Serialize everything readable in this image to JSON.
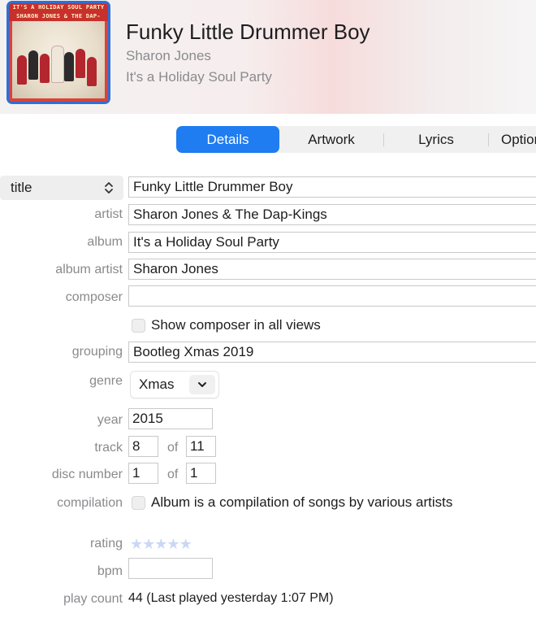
{
  "header": {
    "artwork_text_line1": "IT'S A HOLIDAY SOUL PARTY",
    "artwork_text_line2": "SHARON JONES & THE DAP-KINGS",
    "song_title": "Funky Little Drummer Boy",
    "artist": "Sharon Jones",
    "album": "It's a Holiday Soul Party"
  },
  "tabs": [
    {
      "label": "Details",
      "active": true
    },
    {
      "label": "Artwork",
      "active": false
    },
    {
      "label": "Lyrics",
      "active": false
    },
    {
      "label": "Options",
      "active": false
    }
  ],
  "details": {
    "title_selector": "title",
    "title_value": "Funky Little Drummer Boy",
    "artist_label": "artist",
    "artist_value": "Sharon Jones & The Dap-Kings",
    "album_label": "album",
    "album_value": "It's a Holiday Soul Party",
    "album_artist_label": "album artist",
    "album_artist_value": "Sharon Jones",
    "composer_label": "composer",
    "composer_value": "",
    "show_composer_label": "Show composer in all views",
    "grouping_label": "grouping",
    "grouping_value": "Bootleg Xmas 2019",
    "genre_label": "genre",
    "genre_value": "Xmas",
    "year_label": "year",
    "year_value": "2015",
    "track_label": "track",
    "track_value": "8",
    "track_of_label": "of",
    "track_total": "11",
    "disc_label": "disc number",
    "disc_value": "1",
    "disc_of_label": "of",
    "disc_total": "1",
    "compilation_label": "compilation",
    "compilation_text": "Album is a compilation of songs by various artists",
    "rating_label": "rating",
    "rating_value": 0,
    "rating_max": 5,
    "bpm_label": "bpm",
    "bpm_value": "",
    "play_count_label": "play count",
    "play_count_value": "44 (Last played yesterday 1:07 PM)"
  },
  "colors": {
    "accent": "#1f7cf1",
    "label_gray": "#8a8a8e",
    "star_empty": "#c9d8f5"
  }
}
